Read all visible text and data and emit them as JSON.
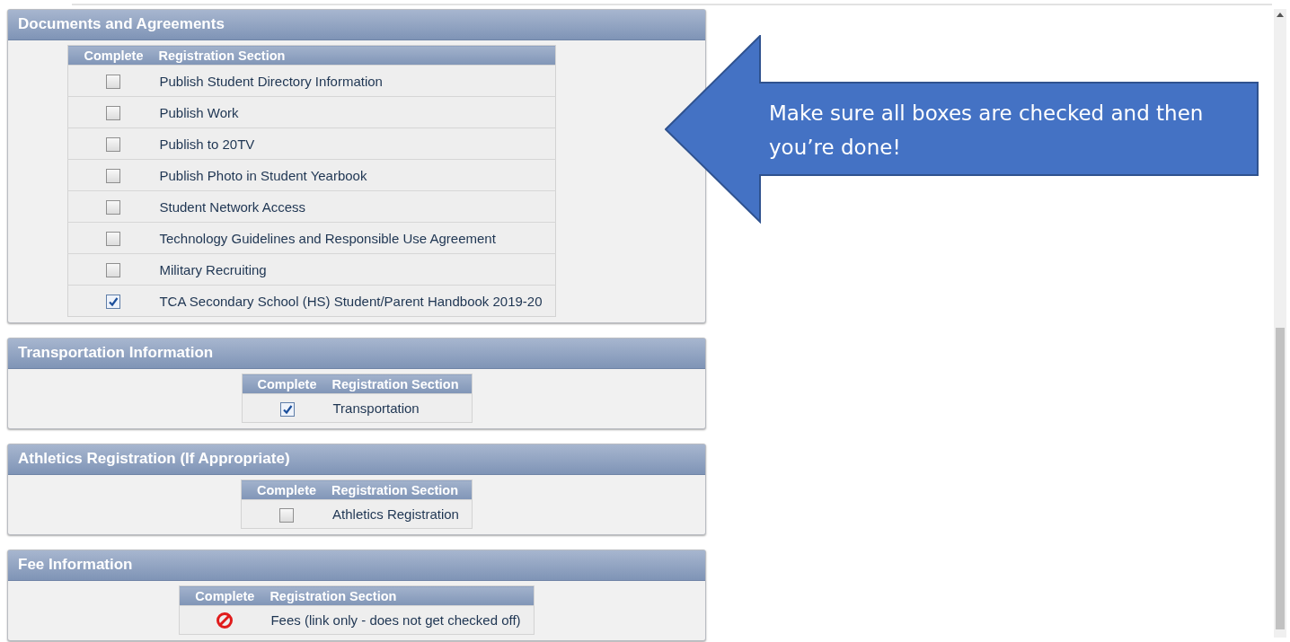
{
  "sections": [
    {
      "title": "Documents and Agreements",
      "columns": [
        "Complete",
        "Registration Section"
      ],
      "rows": [
        {
          "kind": "checkbox",
          "checked": false,
          "label": "Publish Student Directory Information"
        },
        {
          "kind": "checkbox",
          "checked": false,
          "label": "Publish Work"
        },
        {
          "kind": "checkbox",
          "checked": false,
          "label": "Publish to 20TV"
        },
        {
          "kind": "checkbox",
          "checked": false,
          "label": "Publish Photo in Student Yearbook"
        },
        {
          "kind": "checkbox",
          "checked": false,
          "label": "Student Network Access"
        },
        {
          "kind": "checkbox",
          "checked": false,
          "label": "Technology Guidelines and Responsible Use Agreement"
        },
        {
          "kind": "checkbox",
          "checked": false,
          "label": "Military Recruiting"
        },
        {
          "kind": "checkbox",
          "checked": true,
          "label": "TCA Secondary School (HS) Student/Parent Handbook 2019-20"
        }
      ]
    },
    {
      "title": "Transportation Information",
      "columns": [
        "Complete",
        "Registration Section"
      ],
      "rows": [
        {
          "kind": "checkbox",
          "checked": true,
          "label": "Transportation"
        }
      ]
    },
    {
      "title": "Athletics Registration (If Appropriate)",
      "columns": [
        "Complete",
        "Registration Section"
      ],
      "rows": [
        {
          "kind": "checkbox",
          "checked": false,
          "label": "Athletics Registration"
        }
      ]
    },
    {
      "title": "Fee Information",
      "columns": [
        "Complete",
        "Registration Section"
      ],
      "rows": [
        {
          "kind": "blocked",
          "label": "Fees (link only - does not get checked off)"
        }
      ]
    }
  ],
  "callout": {
    "text": "Make sure all boxes are checked and then you’re done!"
  }
}
